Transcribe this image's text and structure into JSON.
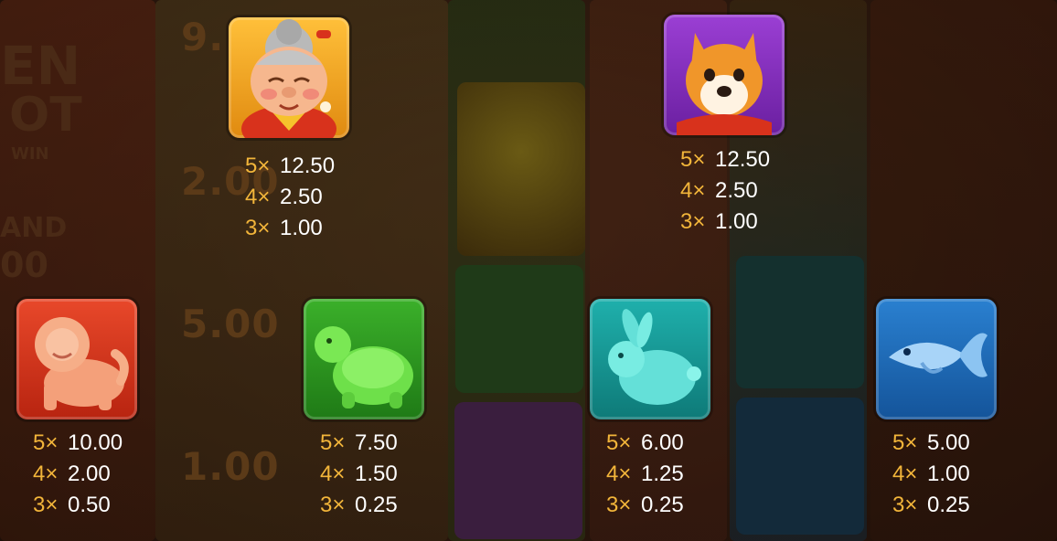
{
  "background": {
    "logo_lines": [
      "EN",
      "OT",
      "WIN"
    ],
    "side_label": "AND",
    "side_value": "00",
    "column_values": [
      "9.",
      "2.00",
      "5.00",
      "1.00"
    ]
  },
  "symbols": [
    {
      "icon": "grandma-icon",
      "color": "#f0a020",
      "payouts": [
        {
          "mult": "5×",
          "value": "12.50"
        },
        {
          "mult": "4×",
          "value": "2.50"
        },
        {
          "mult": "3×",
          "value": "1.00"
        }
      ]
    },
    {
      "icon": "shiba-dog-icon",
      "color": "#8a2fc0",
      "payouts": [
        {
          "mult": "5×",
          "value": "12.50"
        },
        {
          "mult": "4×",
          "value": "2.50"
        },
        {
          "mult": "3×",
          "value": "1.00"
        }
      ]
    },
    {
      "icon": "lion-foo-dog-icon",
      "color": "#d83a1c",
      "payouts": [
        {
          "mult": "5×",
          "value": "10.00"
        },
        {
          "mult": "4×",
          "value": "2.00"
        },
        {
          "mult": "3×",
          "value": "0.50"
        }
      ]
    },
    {
      "icon": "turtle-icon",
      "color": "#2f9b22",
      "payouts": [
        {
          "mult": "5×",
          "value": "7.50"
        },
        {
          "mult": "4×",
          "value": "1.50"
        },
        {
          "mult": "3×",
          "value": "0.25"
        }
      ]
    },
    {
      "icon": "rabbit-icon",
      "color": "#14908e",
      "payouts": [
        {
          "mult": "5×",
          "value": "6.00"
        },
        {
          "mult": "4×",
          "value": "1.25"
        },
        {
          "mult": "3×",
          "value": "0.25"
        }
      ]
    },
    {
      "icon": "fish-icon",
      "color": "#1e6cb8",
      "payouts": [
        {
          "mult": "5×",
          "value": "5.00"
        },
        {
          "mult": "4×",
          "value": "1.00"
        },
        {
          "mult": "3×",
          "value": "0.25"
        }
      ]
    }
  ]
}
